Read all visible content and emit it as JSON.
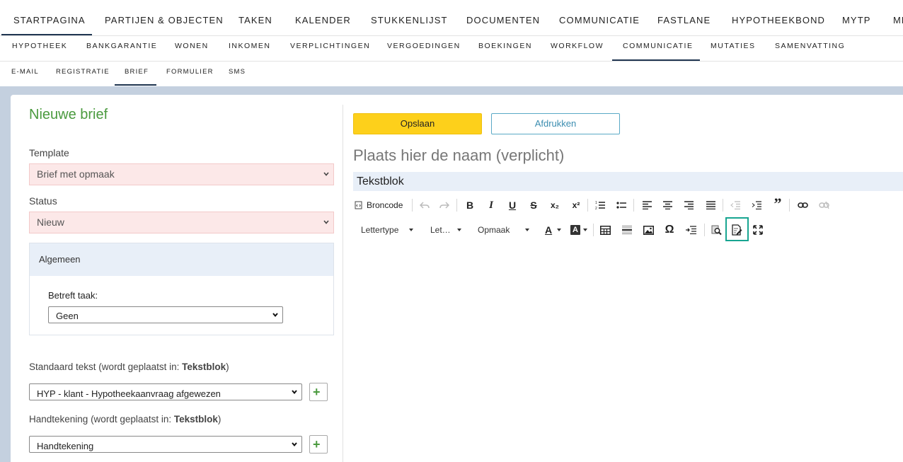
{
  "nav_main": [
    "STARTPAGINA",
    "PARTIJEN & OBJECTEN",
    "TAKEN",
    "KALENDER",
    "STUKKENLIJST",
    "DOCUMENTEN",
    "COMMUNICATIE",
    "FASTLANE",
    "HYPOTHEEKBOND",
    "MYTP",
    "ME"
  ],
  "nav_sub": [
    "HYPOTHEEK",
    "BANKGARANTIE",
    "WONEN",
    "INKOMEN",
    "VERPLICHTINGEN",
    "VERGOEDINGEN",
    "BOEKINGEN",
    "WORKFLOW",
    "COMMUNICATIE",
    "MUTATIES",
    "SAMENVATTING"
  ],
  "nav_tabs": [
    "E-MAIL",
    "REGISTRATIE",
    "BRIEF",
    "FORMULIER",
    "SMS"
  ],
  "form": {
    "title": "Nieuwe brief",
    "template_label": "Template",
    "template_value": "Brief met opmaak",
    "status_label": "Status",
    "status_value": "Nieuw",
    "algemeen_title": "Algemeen",
    "betreft_label": "Betreft taak:",
    "betreft_value": "Geen",
    "standaard_label_prefix": "Standaard tekst (wordt geplaatst in: ",
    "standaard_label_bold": "Tekstblok",
    "standaard_label_suffix": ")",
    "standaard_value": "HYP - klant - Hypotheekaanvraag afgewezen",
    "handtekening_label_prefix": "Handtekening (wordt geplaatst in: ",
    "handtekening_label_bold": "Tekstblok",
    "handtekening_label_suffix": ")",
    "handtekening_value": "Handtekening",
    "plus": "+"
  },
  "editor": {
    "save_label": "Opslaan",
    "print_label": "Afdrukken",
    "name_placeholder": "Plaats hier de naam (verplicht)",
    "tekstblok_label": "Tekstblok",
    "broncode_label": "Broncode",
    "font_label": "Lettertype",
    "size_label": "Let…",
    "format_label": "Opmaak",
    "bold": "B",
    "italic": "I",
    "underline": "U",
    "strike": "S",
    "subscript": "x₂",
    "superscript": "x²",
    "quote": "”",
    "omega": "Ω",
    "text_color": "A",
    "bg_color": "A"
  },
  "colors": {
    "accent_green": "#4a9a3e",
    "save_yellow": "#fdd01b",
    "print_blue": "#3b8db0",
    "highlight_teal": "#18a591",
    "nav_underline": "#1f3550"
  }
}
